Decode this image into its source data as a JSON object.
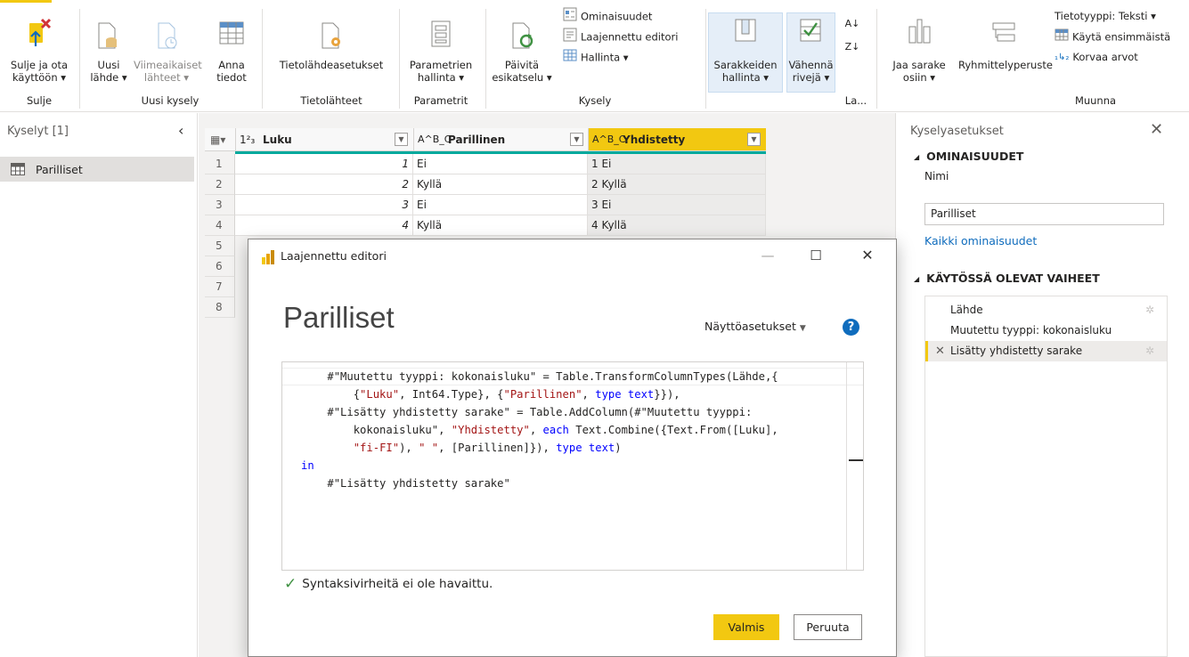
{
  "ribbon": {
    "buttons": {
      "close_apply": "Sulje ja ota käyttöön ▾",
      "new_source": "Uusi lähde ▾",
      "recent_sources": "Viimeaikaiset lähteet ▾",
      "enter_data": "Anna tiedot",
      "data_source_settings": "Tietolähdeasetukset",
      "manage_parameters": "Parametrien hallinta ▾",
      "refresh_preview": "Päivitä esikatselu ▾",
      "properties": "Ominaisuudet",
      "advanced_editor": "Laajennettu editori",
      "manage": "Hallinta ▾",
      "choose_columns": "Sarakkeiden hallinta ▾",
      "reduce_rows": "Vähennä rivejä ▾",
      "split_column": "Jaa sarake osiin ▾",
      "group_by": "Ryhmittelyperuste",
      "data_type": "Tietotyyppi: Teksti ▾",
      "use_first_row": "Käytä ensimmäistä",
      "replace_values": "Korvaa arvot"
    },
    "groups": {
      "close": "Sulje",
      "new_query": "Uusi kysely",
      "data_sources": "Tietolähteet",
      "parameters": "Parametrit",
      "query": "Kysely",
      "sort": "La...",
      "transform": "Muunna"
    }
  },
  "queries_pane": {
    "title": "Kyselyt [1]",
    "items": [
      "Parilliset"
    ]
  },
  "grid": {
    "columns": [
      {
        "type": "1²₃",
        "name": "Luku"
      },
      {
        "type": "A^B_C",
        "name": "Parillinen"
      },
      {
        "type": "A^B_C",
        "name": "Yhdistetty"
      }
    ],
    "rows": [
      {
        "n": "1",
        "luku": "1",
        "par": "Ei",
        "yhd": "1 Ei"
      },
      {
        "n": "2",
        "luku": "2",
        "par": "Kyllä",
        "yhd": "2 Kyllä"
      },
      {
        "n": "3",
        "luku": "3",
        "par": "Ei",
        "yhd": "3 Ei"
      },
      {
        "n": "4",
        "luku": "4",
        "par": "Kyllä",
        "yhd": "4 Kyllä"
      },
      {
        "n": "5"
      },
      {
        "n": "6"
      },
      {
        "n": "7"
      },
      {
        "n": "8"
      }
    ]
  },
  "settings_pane": {
    "title": "Kyselyasetukset",
    "properties_heading": "OMINAISUUDET",
    "name_label": "Nimi",
    "name_value": "Parilliset",
    "all_properties": "Kaikki ominaisuudet",
    "steps_heading": "KÄYTÖSSÄ OLEVAT VAIHEET",
    "steps": [
      "Lähde",
      "Muutettu tyyppi: kokonaisluku",
      "Lisätty yhdistetty sarake"
    ]
  },
  "dialog": {
    "window_title": "Laajennettu editori",
    "query_name": "Parilliset",
    "display_options": "Näyttöasetukset",
    "status": "Syntaksivirheitä ei ole havaittu.",
    "done": "Valmis",
    "cancel": "Peruuta",
    "code": {
      "l1_a": "#\"Muutettu tyyppi: kokonaisluku\" = Table.TransformColumnTypes(Lähde,{",
      "l2_a": "    {",
      "l2_s1": "\"Luku\"",
      "l2_b": ", Int64.Type}, {",
      "l2_s2": "\"Parillinen\"",
      "l2_c": ", ",
      "l2_k1": "type text",
      "l2_d": "}}),",
      "l3": "#\"Lisätty yhdistetty sarake\" = Table.AddColumn(#\"Muutettu tyyppi:",
      "l4_a": "    kokonaisluku\", ",
      "l4_s": "\"Yhdistetty\"",
      "l4_b": ", ",
      "l4_k": "each",
      "l4_c": " Text.Combine({Text.From([Luku],",
      "l5_a": "    ",
      "l5_s1": "\"fi-FI\"",
      "l5_b": "), ",
      "l5_s2": "\" \"",
      "l5_c": ", [Parillinen]}), ",
      "l5_k": "type text",
      "l5_d": ")",
      "l6_k": "in",
      "l7": "#\"Lisätty yhdistetty sarake\""
    }
  },
  "colors": {
    "accent": "#f2c811",
    "teal": "#00a99d",
    "link": "#0f6cbd",
    "string": "#a31515",
    "keyword": "#0000ff"
  }
}
